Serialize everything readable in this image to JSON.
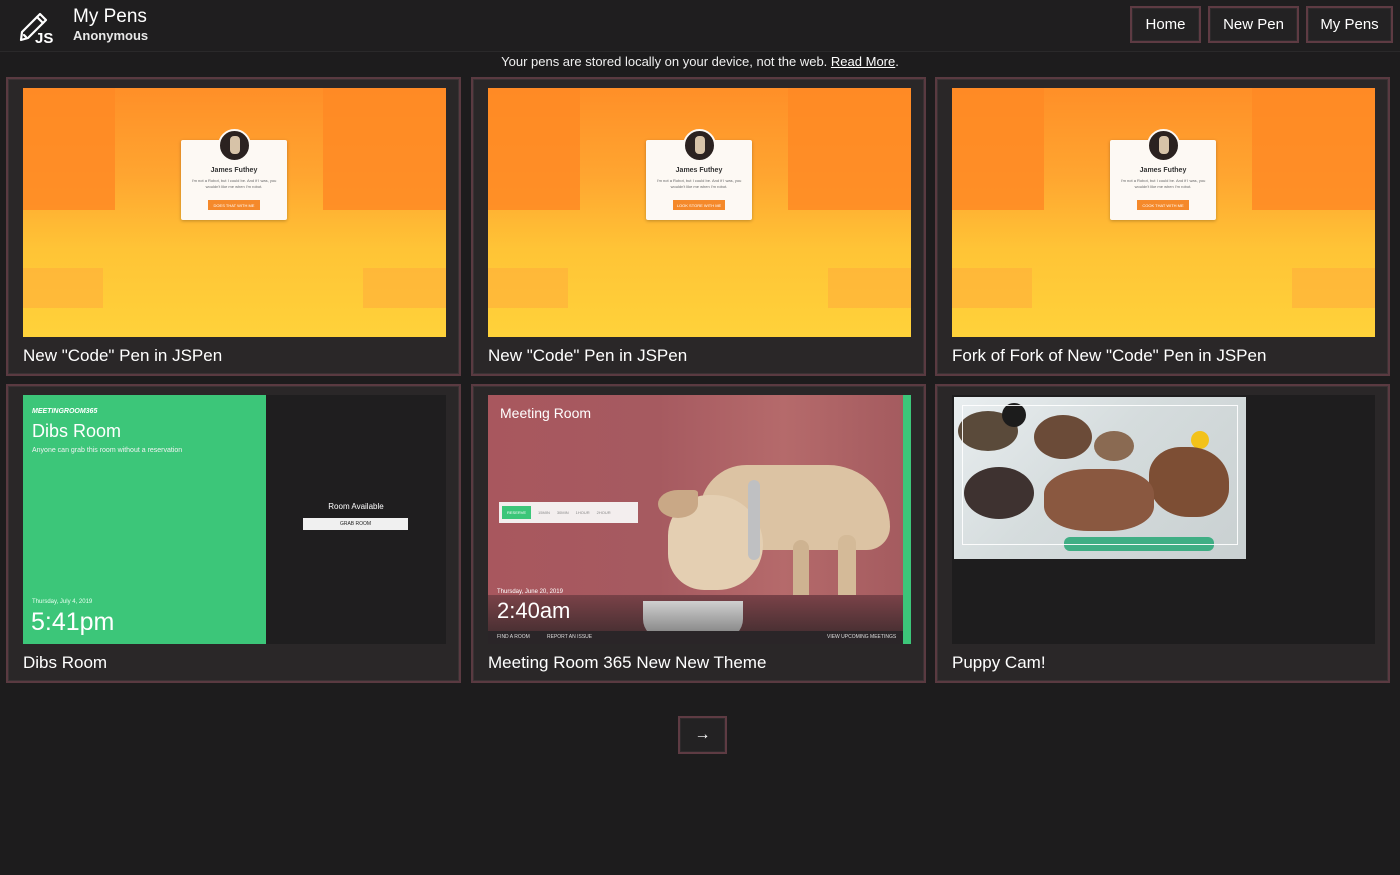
{
  "header": {
    "logo_text": "JS",
    "title": "My Pens",
    "subtitle": "Anonymous",
    "nav": [
      "Home",
      "New Pen",
      "My Pens"
    ]
  },
  "notice": {
    "text": "Your pens are stored locally on your device, not the web.",
    "link": "Read More",
    "trailing": "."
  },
  "pens": [
    {
      "title": "New \"Code\" Pen in JSPen",
      "thumb": "profile",
      "profile": {
        "name": "James Futhey",
        "text": "I'm not a Robot, but I could be. And if I was, you wouldn't like me when I'm robot.",
        "button": "DOES THAT WITH ME"
      }
    },
    {
      "title": "New \"Code\" Pen in JSPen",
      "thumb": "profile",
      "profile": {
        "name": "James Futhey",
        "text": "I'm not a Robot, but I could be. And if I was, you wouldn't like me when I'm robot.",
        "button": "LOOK STORE WITH ME"
      }
    },
    {
      "title": "Fork of Fork of New \"Code\" Pen in JSPen",
      "thumb": "profile",
      "profile": {
        "name": "James Futhey",
        "text": "I'm not a Robot, but I could be. And if I was, you wouldn't like me when I'm robot.",
        "button": "COOK THAT WITH ME"
      }
    },
    {
      "title": "Dibs Room",
      "thumb": "dibs",
      "dibs": {
        "brand": "MEETINGROOM365",
        "room": "Dibs Room",
        "description": "Anyone can grab this room without a reservation",
        "date": "Thursday, July 4, 2019",
        "time": "5:41pm",
        "status": "Room Available",
        "button": "GRAB ROOM"
      }
    },
    {
      "title": "Meeting Room 365 New New Theme",
      "thumb": "meeting",
      "meeting": {
        "room": "Meeting Room",
        "tabs": [
          "RESERVE",
          "15MIN",
          "30MIN",
          "1HOUR",
          "2HOUR"
        ],
        "date": "Thursday, June 20, 2019",
        "time": "2:40am",
        "links": [
          "FIND A ROOM",
          "REPORT AN ISSUE",
          "VIEW UPCOMING MEETINGS"
        ]
      }
    },
    {
      "title": "Puppy Cam!",
      "thumb": "camera"
    }
  ],
  "pager": {
    "next": "→"
  },
  "colors": {
    "background": "#1d1c1d",
    "card_border": "#5a3a41",
    "green": "#3cc679",
    "orange": "#ff8f28"
  }
}
